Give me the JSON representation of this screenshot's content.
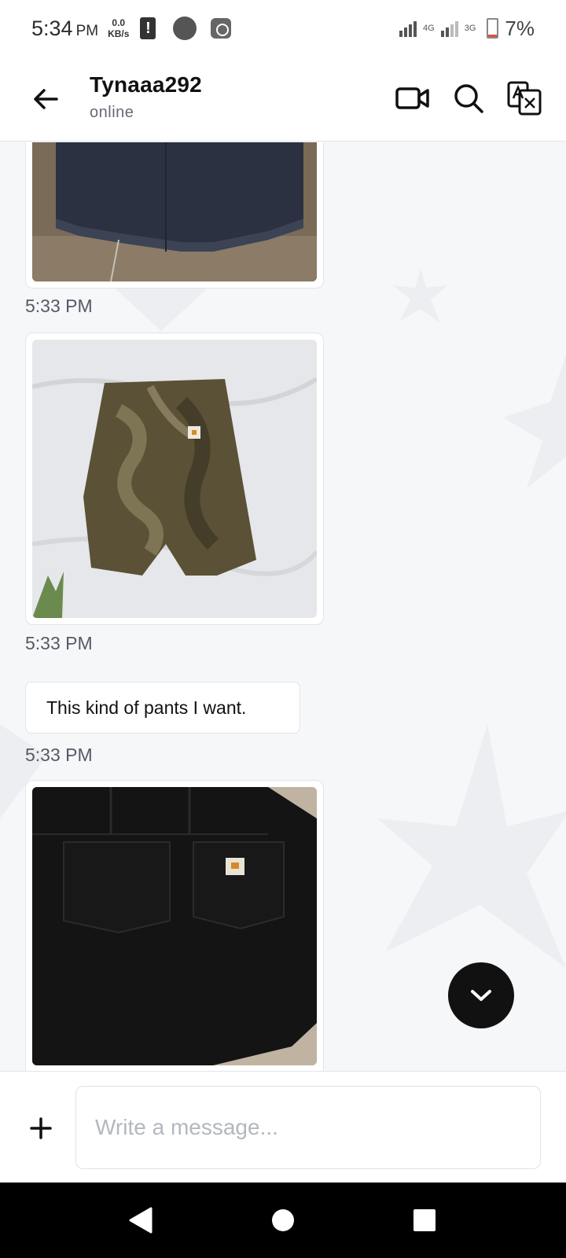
{
  "status_bar": {
    "time": "5:34",
    "ampm": "PM",
    "net_speed_value": "0.0",
    "net_speed_unit": "KB/s",
    "alert_glyph": "!",
    "net_4g": "4G",
    "net_3g": "3G",
    "battery": "7%",
    "icons": [
      "alert-icon",
      "circle-icon",
      "app-icon",
      "signal-icon",
      "battery-icon"
    ]
  },
  "header": {
    "contact_name": "Tynaaa292",
    "contact_status": "online",
    "icons": [
      "back-arrow-icon",
      "video-call-icon",
      "search-icon",
      "translate-icon"
    ]
  },
  "messages": [
    {
      "type": "image",
      "photo": "dark denim shorts",
      "time": "5:33 PM"
    },
    {
      "type": "image",
      "photo": "camouflage cargo shorts",
      "time": "5:33 PM"
    },
    {
      "type": "text",
      "text": "This kind of pants I want.",
      "time": "5:33 PM"
    },
    {
      "type": "image",
      "photo": "black carpenter shorts"
    }
  ],
  "composer": {
    "placeholder": "Write a message..."
  },
  "nav": {
    "icons": [
      "back-triangle-icon",
      "home-circle-icon",
      "recents-square-icon"
    ]
  },
  "colors": {
    "header_bg": "#ffffff",
    "chat_bg": "#f6f7f9",
    "fab": "#111111",
    "muted_text": "#545a66"
  }
}
